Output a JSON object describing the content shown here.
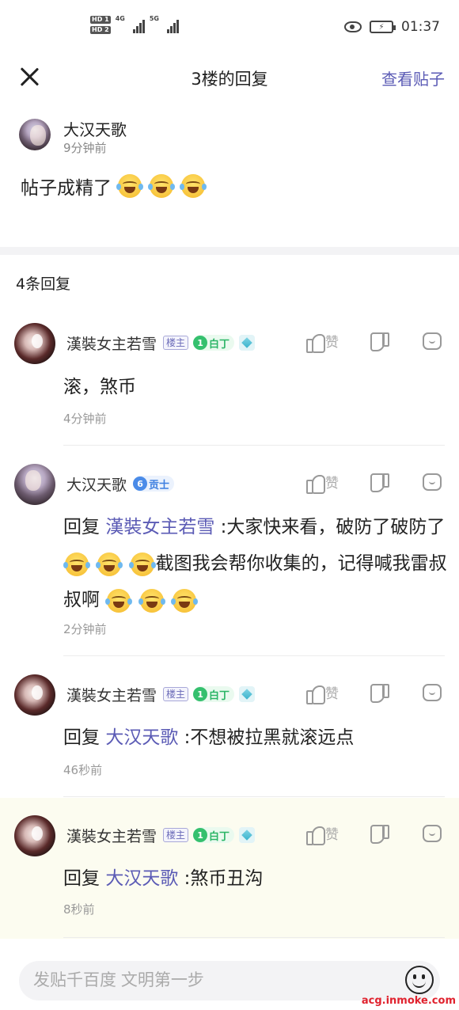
{
  "status_bar": {
    "hd1": "HD 1",
    "hd2": "HD 2",
    "net1": "4G",
    "net2": "5G",
    "time": "01:37"
  },
  "nav": {
    "title": "3楼的回复",
    "action": "查看贴子"
  },
  "post": {
    "author": "大汉天歌",
    "time": "9分钟前",
    "text": "帖子成精了"
  },
  "reply_count": "4条回复",
  "labels": {
    "like": "赞",
    "reply_prefix": "回复"
  },
  "replies": [
    {
      "author": "漢裝女主若雪",
      "owner_badge": "楼主",
      "level": "1",
      "level_title": "白丁",
      "text": "滚，煞币",
      "time": "4分钟前"
    },
    {
      "author": "大汉天歌",
      "level": "6",
      "level_title": "贡士",
      "mention": "漢裝女主若雪",
      "text_a": ":大家快来看，破防了破防了",
      "text_b": "截图我会帮你收集的，记得喊我雷叔叔啊",
      "time": "2分钟前"
    },
    {
      "author": "漢裝女主若雪",
      "owner_badge": "楼主",
      "level": "1",
      "level_title": "白丁",
      "mention": "大汉天歌",
      "text": ":不想被拉黑就滚远点",
      "time": "46秒前"
    },
    {
      "author": "漢裝女主若雪",
      "owner_badge": "楼主",
      "level": "1",
      "level_title": "白丁",
      "mention": "大汉天歌",
      "text": ":煞币丑沟",
      "time": "8秒前"
    }
  ],
  "input": {
    "placeholder": "发贴千百度 文明第一步"
  },
  "watermark": "acg.inmoke.com",
  "colors": {
    "accent": "#5b5bb5",
    "level_green": "#35c06e",
    "level_blue": "#4a8be8",
    "highlight_row": "#fcfcf0"
  }
}
